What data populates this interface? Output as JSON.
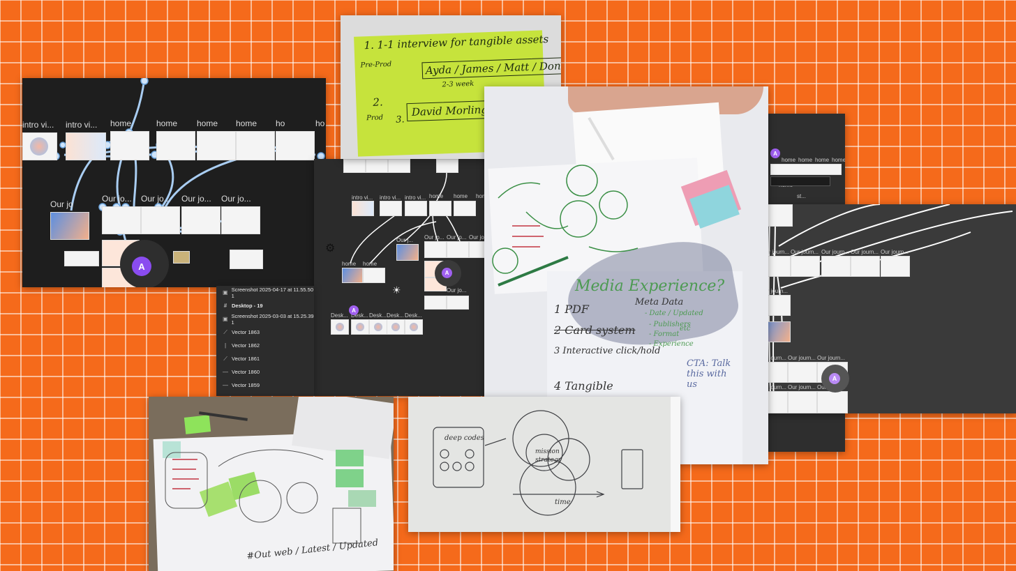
{
  "frames": {
    "canvas_top_left": {
      "row1_labels": [
        "intro vi...",
        "intro vi...",
        "home",
        "home",
        "home",
        "home",
        "ho"
      ],
      "row2_labels": [
        "Our jo...",
        "Our jo...",
        "Our jo...",
        "Our jo..."
      ],
      "row2_first_label": "Our jo",
      "avatar_initial": "A"
    },
    "canvas_middle": {
      "row1_labels": [
        "intro vi...",
        "intro vi...",
        "home",
        "home",
        "home"
      ],
      "row2_labels": [
        "Our j...",
        "Our jo...",
        "Our jo...",
        "Our jo...",
        "Our jo..."
      ],
      "desk_labels": [
        "Desk...",
        "Desk...",
        "Desk...",
        "Desk...",
        "Desk..."
      ],
      "sub_labels": [
        "home",
        "home"
      ],
      "avatar_initial": "A"
    },
    "layers_panel": {
      "items": [
        {
          "icon": "image-icon",
          "label": "Screenshot 2025-04-17 at 11.55.50 1",
          "bold": false
        },
        {
          "icon": "frame-icon",
          "label": "Desktop - 19",
          "bold": true
        },
        {
          "icon": "image-icon",
          "label": "Screenshot 2025-03-03 at 15.25.39 1",
          "bold": false
        },
        {
          "icon": "vector-icon",
          "label": "Vector 1863",
          "bold": false
        },
        {
          "icon": "vector-icon",
          "label": "Vector 1862",
          "bold": false
        },
        {
          "icon": "vector-icon",
          "label": "Vector 1861",
          "bold": false
        },
        {
          "icon": "vector-icon",
          "label": "Vector 1860",
          "bold": false
        },
        {
          "icon": "vector-icon",
          "label": "Vector 1859",
          "bold": false
        }
      ]
    },
    "canvas_right": {
      "top_labels": [
        "home",
        "home",
        "home",
        "home"
      ],
      "row_labels": [
        "Our journ...",
        "Our journ...",
        "Our journ...",
        "Our journ...",
        "Our journ..."
      ],
      "left_labels": [
        "Our journ...",
        "Our journ...",
        "Our journ..."
      ],
      "bottom_labels": [
        "Our journ...",
        "Our journ...",
        "Our journ..."
      ],
      "small_labels": [
        "home",
        "st..."
      ],
      "avatar_initial": "A"
    },
    "sticky_note": {
      "lines": [
        "1. 1-1 interview for tangible assets",
        "Pre-Prod",
        "Ayda / James / Matt / Don",
        "2-3 week",
        "2.",
        "Prod",
        "David Morling List",
        "3."
      ]
    },
    "whiteboard_paper": {
      "title": "Media Experience?",
      "items": [
        "1 PDF",
        "2 Card system",
        "3 Interactive click/hold",
        "4 Tangible"
      ],
      "side": [
        "Meta Data",
        "- Date / Updated",
        "- Publishers",
        "- Format",
        "- Experience",
        "etc"
      ],
      "cta": "CTA: Talk this with us"
    },
    "desk_paper": {
      "bottom_text": "#Out web / Latest / Updated"
    },
    "whiteboard": {
      "left": "deep codes",
      "center": [
        "mission",
        "strategy",
        "time"
      ]
    }
  }
}
